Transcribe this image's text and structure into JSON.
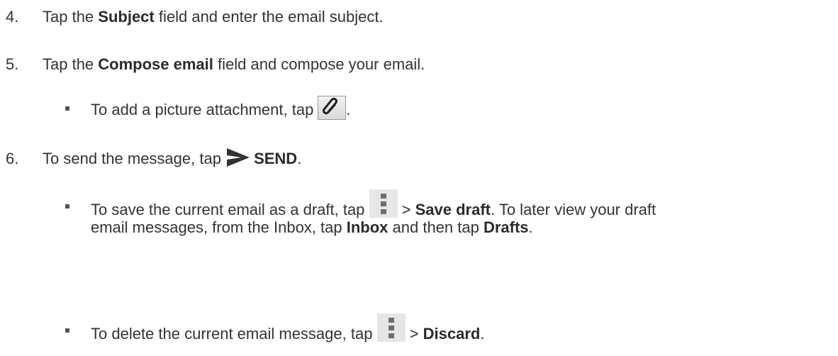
{
  "steps": [
    {
      "num": "4.",
      "pre": "Tap the ",
      "bold": "Subject",
      "post": " field and enter the email subject."
    },
    {
      "num": "5.",
      "pre": "Tap the ",
      "bold": "Compose email",
      "post": " field and compose your email."
    },
    {
      "num": "6.",
      "pre": "To send the message, tap ",
      "bold": "SEND",
      "post": "."
    }
  ],
  "attach_bullet": {
    "text": "To add a picture attachment, tap ",
    "end": "."
  },
  "draft_bullet": {
    "pre": "To save the current email as a draft, tap ",
    "mid": " > ",
    "bold1": "Save draft",
    "mid2": ". To later view your draft",
    "line2_pre": "email messages, from the Inbox, tap ",
    "bold2": "Inbox",
    "line2_mid": " and then tap ",
    "bold3": "Drafts",
    "line2_end": "."
  },
  "discard_bullet": {
    "pre": "To delete the current email message, tap ",
    "mid": " > ",
    "bold": "Discard",
    "end": "."
  },
  "icons": {
    "attach": "paperclip-icon",
    "send": "send-arrow-icon",
    "menu": "overflow-menu-icon"
  }
}
